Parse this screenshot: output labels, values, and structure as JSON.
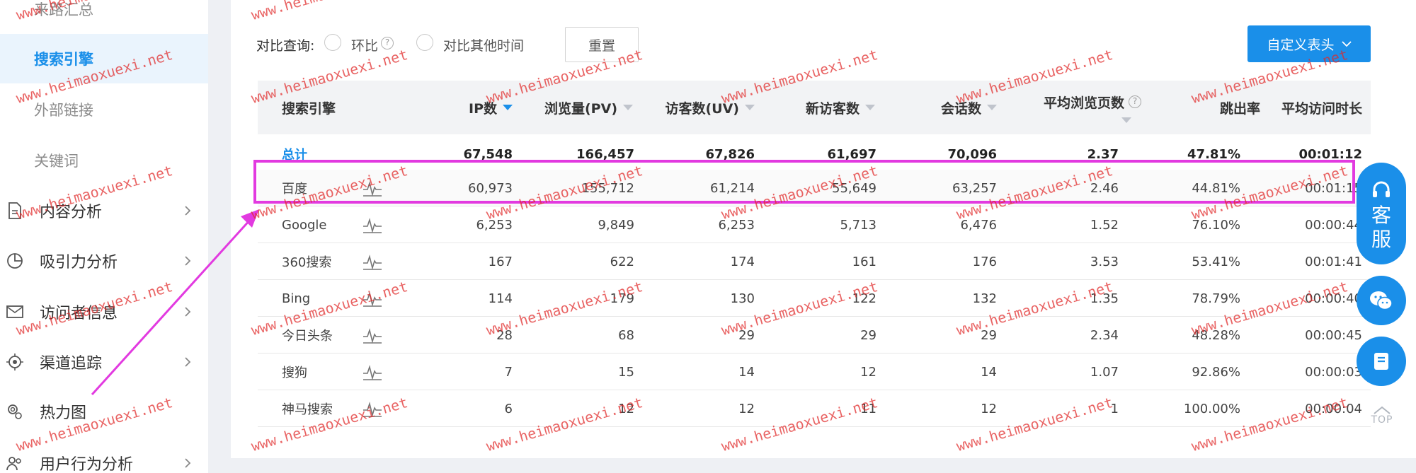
{
  "sidebar": {
    "sub_items": [
      "来路汇总",
      "搜索引擎",
      "外部链接",
      "关键词"
    ],
    "nav_items": [
      {
        "label": "内容分析",
        "icon": "document-icon"
      },
      {
        "label": "吸引力分析",
        "icon": "pie-chart-icon"
      },
      {
        "label": "访问者信息",
        "icon": "mail-icon"
      },
      {
        "label": "渠道追踪",
        "icon": "target-icon"
      },
      {
        "label": "热力图",
        "icon": "heatmap-icon"
      },
      {
        "label": "用户行为分析",
        "icon": "users-icon"
      }
    ]
  },
  "toolbar": {
    "compare_label": "对比查询:",
    "option_mom": "环比",
    "option_other": "对比其他时间",
    "reset_label": "重置",
    "custom_header_label": "自定义表头"
  },
  "table": {
    "headers": [
      "搜索引擎",
      "IP数",
      "浏览量(PV)",
      "访客数(UV)",
      "新访客数",
      "会话数",
      "平均浏览页数",
      "跳出率",
      "平均访问时长"
    ],
    "total": [
      "总计",
      "67,548",
      "166,457",
      "67,826",
      "61,697",
      "70,096",
      "2.37",
      "47.81%",
      "00:01:12"
    ],
    "rows": [
      [
        "百度",
        "60,973",
        "155,712",
        "61,214",
        "55,649",
        "63,257",
        "2.46",
        "44.81%",
        "00:01:15"
      ],
      [
        "Google",
        "6,253",
        "9,849",
        "6,253",
        "5,713",
        "6,476",
        "1.52",
        "76.10%",
        "00:00:44"
      ],
      [
        "360搜索",
        "167",
        "622",
        "174",
        "161",
        "176",
        "3.53",
        "53.41%",
        "00:01:41"
      ],
      [
        "Bing",
        "114",
        "179",
        "130",
        "122",
        "132",
        "1.35",
        "78.79%",
        "00:00:40"
      ],
      [
        "今日头条",
        "28",
        "68",
        "29",
        "29",
        "29",
        "2.34",
        "48.28%",
        "00:00:45"
      ],
      [
        "搜狗",
        "7",
        "15",
        "14",
        "12",
        "14",
        "1.07",
        "92.86%",
        "00:00:03"
      ],
      [
        "神马搜索",
        "6",
        "12",
        "12",
        "11",
        "12",
        "1",
        "100.00%",
        "00:00:04"
      ]
    ]
  },
  "float": {
    "service_label": "客服",
    "top_label": "TOP"
  },
  "watermark": "www.heimaoxuexi.net",
  "colors": {
    "accent": "#1a8fe9",
    "highlight": "#e23ae0",
    "watermark": "#e12828"
  }
}
